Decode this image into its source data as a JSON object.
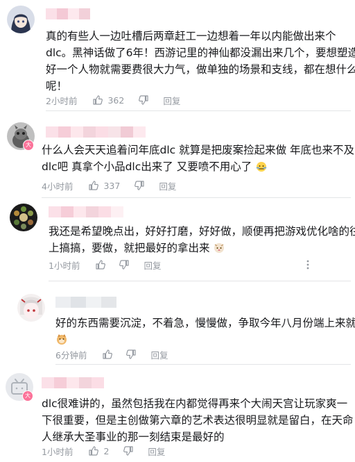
{
  "comments": [
    {
      "lines": [
        "真的有些人一边吐槽后两章赶工一边想着一年以内能做出来个",
        "dlc。黑神话做了6年！西游记里的神仙都没漏出来几个，要想塑造",
        "好一个人物就需要费很大力气，做单独的场景和支线，都在想什么",
        "呢！"
      ],
      "time": "2小时前",
      "likes": "362",
      "reply": "回复"
    },
    {
      "lines": [
        "什么人会天天追着问年底dlc 就算是把废案捡起来做 年底也来不及",
        "dlc吧 真拿个小品dlc出来了 又要喷不用心了"
      ],
      "time": "4小时前",
      "likes": "337",
      "reply": "回复"
    },
    {
      "lines": [
        "我还是希望晚点出，好好打磨，好好做，顺便再把游戏优化啥的往",
        "上搞搞，要做，就把最好的拿出来"
      ],
      "time": "1小时前",
      "likes": "",
      "reply": "回复"
    },
    {
      "lines": [
        "好的东西需要沉淀，不着急，慢慢做，争取今年八月份端上来就好"
      ],
      "time": "6分钟前",
      "likes": "",
      "reply": "回复"
    },
    {
      "lines": [
        "dlc很难讲的，虽然包括我在内都觉得再来个大闹天宫让玩家爽一",
        "下很重要，但是主创做第六章的艺术表达很明显就是留白，在天命",
        "人继承大圣事业的那一刻结束是最好的"
      ],
      "time": "1小时前",
      "likes": "2",
      "reply": "回复"
    }
  ],
  "vip_badge": "大",
  "colors": {
    "text": "#18191c",
    "meta": "#9499a0",
    "divider": "#e3e5e7",
    "badge": "#fb7299"
  }
}
